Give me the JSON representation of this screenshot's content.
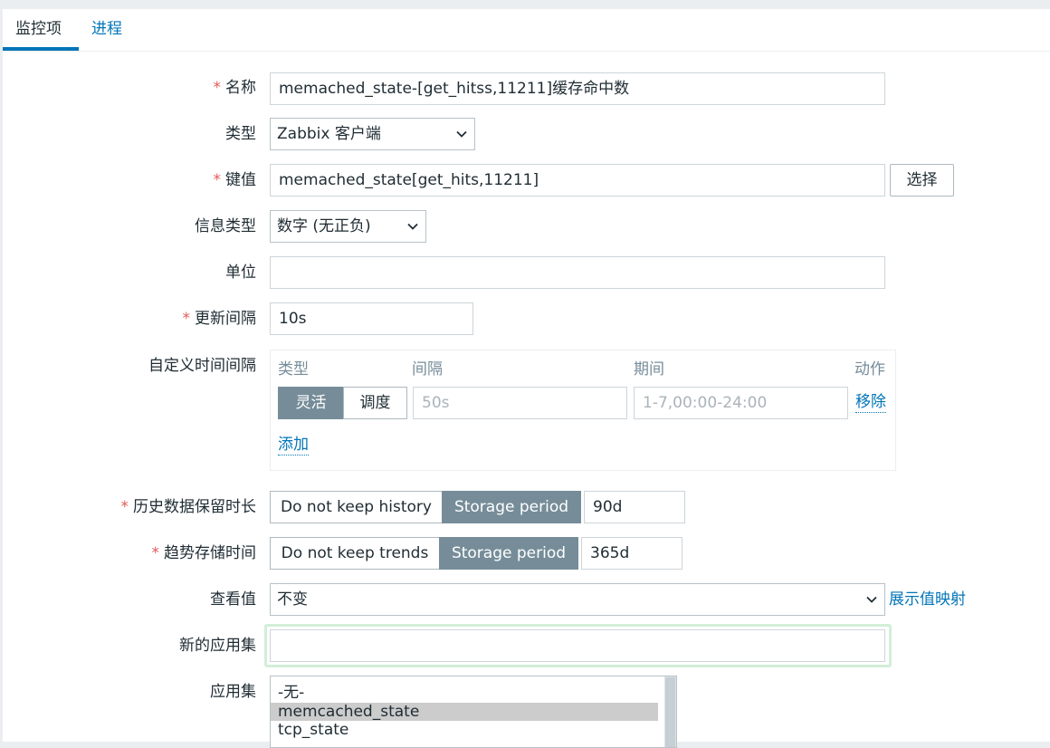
{
  "tabs": [
    {
      "label": "监控项",
      "active": true
    },
    {
      "label": "进程",
      "active": false
    }
  ],
  "form": {
    "name": {
      "label": "名称",
      "required": true,
      "value": "memached_state-[get_hitss,11211]缓存命中数"
    },
    "type": {
      "label": "类型",
      "value": "Zabbix 客户端"
    },
    "key": {
      "label": "键值",
      "required": true,
      "value": "memached_state[get_hits,11211]",
      "select_button": "选择"
    },
    "info_type": {
      "label": "信息类型",
      "value": "数字 (无正负)"
    },
    "units": {
      "label": "单位",
      "value": ""
    },
    "update_interval": {
      "label": "更新间隔",
      "required": true,
      "value": "10s"
    },
    "custom_intervals": {
      "label": "自定义时间间隔",
      "headers": {
        "type": "类型",
        "interval": "间隔",
        "period": "期间",
        "action": "动作"
      },
      "row": {
        "type_options": [
          "灵活",
          "调度"
        ],
        "active_type": "灵活",
        "interval_placeholder": "50s",
        "period_placeholder": "1-7,00:00-24:00",
        "remove": "移除"
      },
      "add": "添加"
    },
    "history": {
      "label": "历史数据保留时长",
      "required": true,
      "options": [
        "Do not keep history",
        "Storage period"
      ],
      "active": "Storage period",
      "value": "90d"
    },
    "trends": {
      "label": "趋势存储时间",
      "required": true,
      "options": [
        "Do not keep trends",
        "Storage period"
      ],
      "active": "Storage period",
      "value": "365d"
    },
    "show_value": {
      "label": "查看值",
      "value": "不变",
      "link": "展示值映射"
    },
    "new_application": {
      "label": "新的应用集",
      "value": ""
    },
    "applications": {
      "label": "应用集",
      "items": [
        "-无-",
        "memcached_state",
        "tcp_state"
      ],
      "selected": "memcached_state"
    }
  },
  "colors": {
    "accent": "#0275b8",
    "required": "#e45959",
    "segment_active": "#768d99",
    "focus_frame": "#d2eed7"
  }
}
